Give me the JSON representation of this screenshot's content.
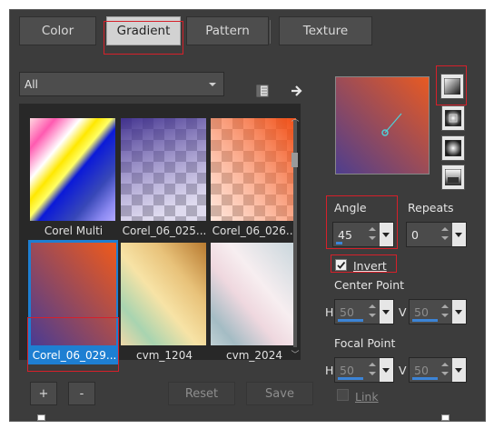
{
  "tabs": [
    {
      "label": "Color",
      "active": false
    },
    {
      "label": "Gradient",
      "active": true
    },
    {
      "label": "Pattern",
      "active": false
    },
    {
      "label": "Texture",
      "active": false
    }
  ],
  "filter": {
    "selected": "All"
  },
  "gradients": [
    {
      "name": "Corel Multi",
      "icon": "corel-multi-gradient",
      "selected": false
    },
    {
      "name": "Corel_06_025...",
      "icon": "purple-checker-gradient",
      "selected": false
    },
    {
      "name": "Corel_06_026...",
      "icon": "orange-checker-gradient",
      "selected": false
    },
    {
      "name": "Corel_06_029...",
      "icon": "orange-purple-gradient",
      "selected": true
    },
    {
      "name": "cvm_1204",
      "icon": "gold-mint-gradient",
      "selected": false
    },
    {
      "name": "cvm_2024",
      "icon": "pink-silver-gradient",
      "selected": false
    }
  ],
  "buttons": {
    "add": "+",
    "remove": "-",
    "reset": "Reset",
    "save": "Save"
  },
  "angle": {
    "label": "Angle",
    "value": "45",
    "fill_percent": 12
  },
  "repeats": {
    "label": "Repeats",
    "value": "0"
  },
  "invert": {
    "label": "Invert",
    "checked": true
  },
  "center_point": {
    "label": "Center Point",
    "h_label": "H",
    "h_value": "50",
    "v_label": "V",
    "v_value": "50"
  },
  "focal_point": {
    "label": "Focal Point",
    "h_label": "H",
    "h_value": "50",
    "v_label": "V",
    "v_value": "50"
  },
  "link": {
    "label": "Link",
    "checked": false
  },
  "colors": {
    "accent": "#1e7fd2",
    "highlight": "#d6202a",
    "gradient_start": "#e85a22",
    "gradient_end": "#4e3e8e"
  },
  "style_icons": [
    "linear-style-icon",
    "rectangular-style-icon",
    "sunburst-style-icon",
    "radial-style-icon"
  ]
}
